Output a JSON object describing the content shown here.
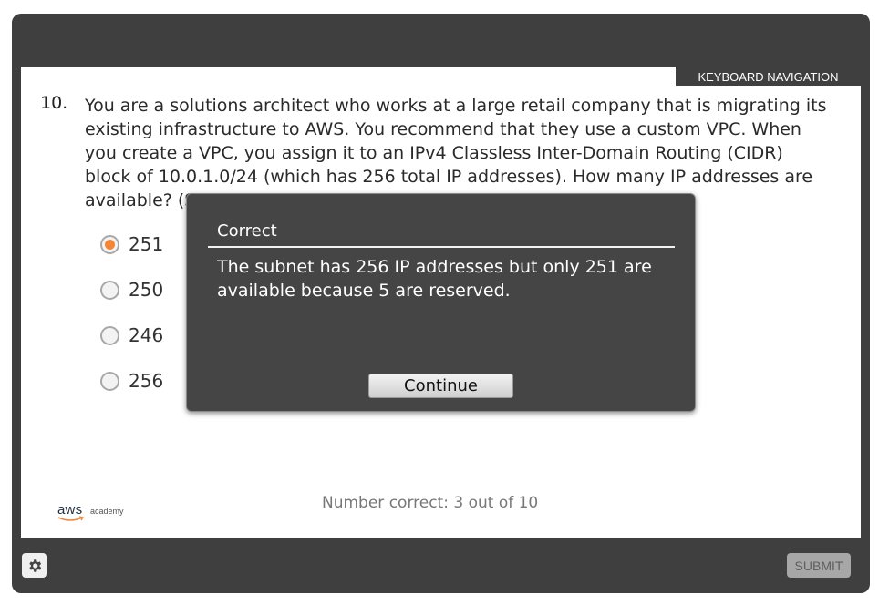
{
  "header": {
    "keyboard_nav_label": "KEYBOARD NAVIGATION"
  },
  "question": {
    "number": "10.",
    "text": "You are a solutions architect who works at a large retail company that is migrating its existing infrastructure to AWS. You recommend that they use a custom VPC. When you create a VPC, you assign it to an IPv4 Classless Inter-Domain Routing (CIDR) block of 10.0.1.0/24 (which has 256 total IP addresses). How many IP addresses are available? (Select the best answer.)"
  },
  "options": [
    {
      "label": "251",
      "selected": true
    },
    {
      "label": "250",
      "selected": false
    },
    {
      "label": "246",
      "selected": false
    },
    {
      "label": "256",
      "selected": false
    }
  ],
  "score_text": "Number correct: 3 out of 10",
  "logo": {
    "aws": "aws",
    "academy": "academy"
  },
  "feedback": {
    "title": "Correct",
    "body": "The subnet has 256 IP addresses but only 251 are available because 5 are reserved.",
    "continue_label": "Continue"
  },
  "footer": {
    "submit_label": "SUBMIT",
    "settings_icon": "gear-icon"
  },
  "colors": {
    "frame": "#3f3f3f",
    "radio_selected": "#f58536",
    "modal_bg": "#454545"
  }
}
